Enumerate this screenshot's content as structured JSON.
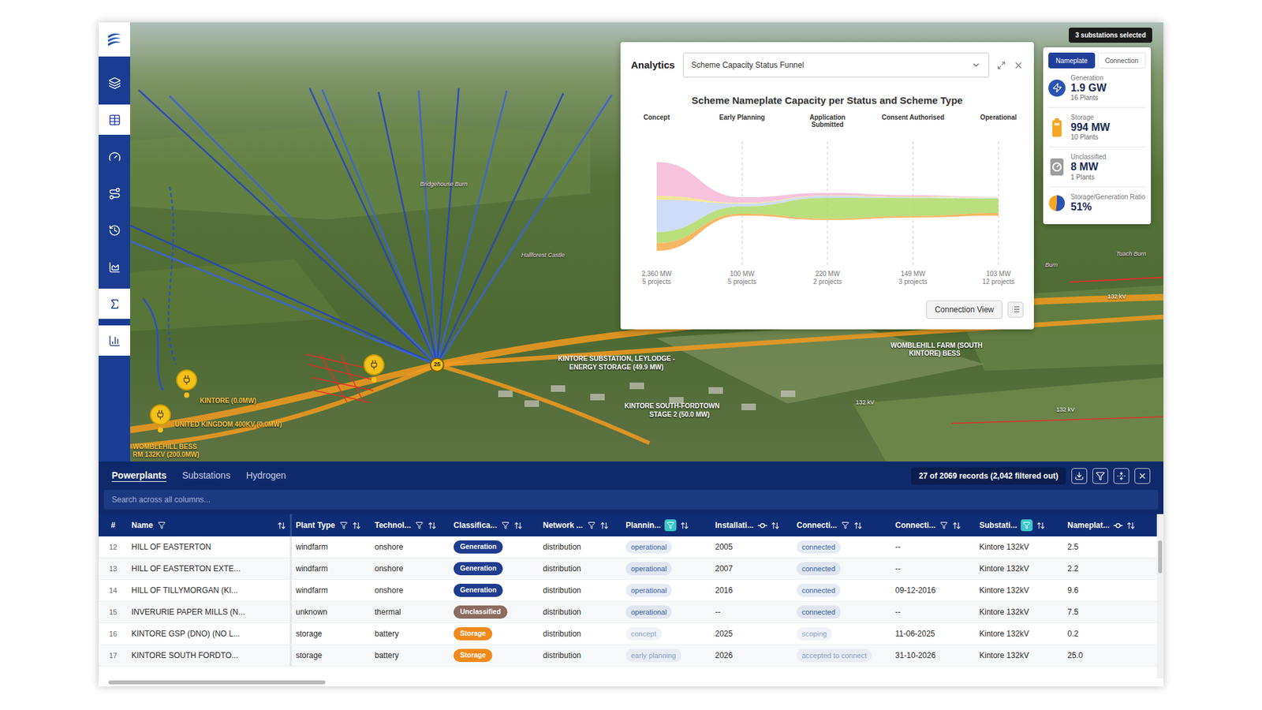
{
  "sidebar": {
    "items": [
      {
        "selected": false
      },
      {
        "selected": true
      },
      {
        "selected": false
      },
      {
        "selected": false
      },
      {
        "selected": false
      },
      {
        "selected": false
      },
      {
        "selected": true
      },
      {
        "selected": true
      }
    ]
  },
  "map": {
    "selection_badge": "3 substations selected",
    "cluster": "25",
    "labels": [
      {
        "text": "KINTORE SUBSTATION, LEYLODGE -",
        "kind": "site"
      },
      {
        "text": "ENERGY STORAGE (49.9 MW)",
        "kind": "site"
      },
      {
        "text": "KINTORE SOUTH-FORDTOWN",
        "kind": "site"
      },
      {
        "text": "STAGE 2 (50.0 MW)",
        "kind": "site"
      },
      {
        "text": "WOMBLEHILL FARM (SOUTH",
        "kind": "site"
      },
      {
        "text": "KINTORE) BESS",
        "kind": "site"
      },
      {
        "text": "132 kV",
        "kind": "voltage"
      },
      {
        "text": "132 kV",
        "kind": "voltage"
      },
      {
        "text": "132 kV",
        "kind": "voltage"
      },
      {
        "text": "Bridgehouse Burn",
        "kind": "place"
      },
      {
        "text": "Hallforest Castle",
        "kind": "place"
      },
      {
        "text": "Tuach Burn",
        "kind": "place"
      },
      {
        "text": "Burn",
        "kind": "place"
      },
      {
        "text": "KINTORE (0.0MW)",
        "kind": "bess"
      },
      {
        "text": "UNITED KINGDOM 400KV (0.0MW)",
        "kind": "bess"
      },
      {
        "text": "WOMBLEHILL BESS",
        "kind": "bess"
      },
      {
        "text": "RM 132KV (200.0MW)",
        "kind": "bess"
      }
    ]
  },
  "analytics": {
    "title": "Analytics",
    "selector": "Scheme Capacity Status Funnel",
    "chart": {
      "title": "Scheme Nameplate Capacity per Status and Scheme Type",
      "stages": [
        {
          "label": "Concept",
          "value": "2,360 MW",
          "projects": "5 projects"
        },
        {
          "label": "Early Planning",
          "value": "100 MW",
          "projects": "5 projects"
        },
        {
          "label": "Application Submitted",
          "value": "220 MW",
          "projects": "2 projects"
        },
        {
          "label": "Consent Authorised",
          "value": "149 MW",
          "projects": "3 projects"
        },
        {
          "label": "Operational",
          "value": "103 MW",
          "projects": "12 projects"
        }
      ],
      "series": [
        {
          "values": [
            900,
            30,
            20,
            9,
            3
          ],
          "color": "#f4b3d3"
        },
        {
          "values": [
            100,
            5,
            5,
            5,
            2
          ],
          "color": "#f3e07c"
        },
        {
          "values": [
            860,
            15,
            15,
            5,
            3
          ],
          "color": "#c2d3f5"
        },
        {
          "values": [
            300,
            40,
            170,
            120,
            80
          ],
          "color": "#a9d75c"
        },
        {
          "values": [
            200,
            10,
            10,
            10,
            15
          ],
          "color": "#f5a53c"
        }
      ]
    },
    "buttons": [
      "Connection View"
    ]
  },
  "summary": {
    "tabs": [
      {
        "label": "Nameplate",
        "selected": true
      },
      {
        "label": "Connection",
        "selected": false
      }
    ],
    "items": [
      {
        "kind": "generation",
        "label": "Generation",
        "value": "1.9 GW",
        "count": "16 Plants"
      },
      {
        "kind": "storage",
        "label": "Storage",
        "value": "994 MW",
        "count": "10 Plants"
      },
      {
        "kind": "unclassified",
        "label": "Unclassified",
        "value": "8 MW",
        "count": "1 Plants"
      },
      {
        "kind": "ratio",
        "label": "Storage/Generation Ratio",
        "value": "51%",
        "level": 0.51
      }
    ]
  },
  "table": {
    "tabs": [
      {
        "label": "Powerplants",
        "selected": true
      },
      {
        "label": "Substations",
        "selected": false
      },
      {
        "label": "Hydrogen",
        "selected": false
      }
    ],
    "records": "27 of 2069 records (2,042 filtered out)",
    "search": {
      "placeholder": "Search across all columns..."
    },
    "columns": [
      {
        "label": "#",
        "kind": "index",
        "filtered": false
      },
      {
        "label": "Name",
        "kind": "list",
        "filtered": false
      },
      {
        "label": "Plant Type",
        "kind": "list",
        "filtered": false
      },
      {
        "label": "Technol...",
        "kind": "list",
        "filtered": false
      },
      {
        "label": "Classifica...",
        "kind": "list",
        "filtered": false
      },
      {
        "label": "Network ...",
        "kind": "list",
        "filtered": false
      },
      {
        "label": "Plannin...",
        "kind": "list",
        "filtered": true
      },
      {
        "label": "Installati...",
        "kind": "range",
        "filtered": false
      },
      {
        "label": "Connecti...",
        "kind": "list",
        "filtered": false
      },
      {
        "label": "Connecti...",
        "kind": "list",
        "filtered": false
      },
      {
        "label": "Substati...",
        "kind": "list",
        "filtered": true
      },
      {
        "label": "Nameplat...",
        "kind": "range",
        "filtered": false
      }
    ],
    "rows": [
      {
        "index": "12",
        "name": "HILL OF EASTERTON",
        "plant_type": "windfarm",
        "technology": "onshore",
        "classification": {
          "text": "Generation",
          "color": "#1f3c8f"
        },
        "network": "distribution",
        "planning": {
          "text": "operational",
          "color": "#3a5fa8"
        },
        "installation": "2005",
        "connection_status": {
          "text": "connected",
          "color": "#3a5fa8"
        },
        "connection_date": "--",
        "substation": "Kintore 132kV",
        "nameplate": "2.5"
      },
      {
        "index": "13",
        "name": "HILL OF EASTERTON EXTE...",
        "plant_type": "windfarm",
        "technology": "onshore",
        "classification": {
          "text": "Generation",
          "color": "#1f3c8f"
        },
        "network": "distribution",
        "planning": {
          "text": "operational",
          "color": "#3a5fa8"
        },
        "installation": "2007",
        "connection_status": {
          "text": "connected",
          "color": "#3a5fa8"
        },
        "connection_date": "--",
        "substation": "Kintore 132kV",
        "nameplate": "2.2"
      },
      {
        "index": "14",
        "name": "HILL OF TILLYMORGAN (KI...",
        "plant_type": "windfarm",
        "technology": "onshore",
        "classification": {
          "text": "Generation",
          "color": "#1f3c8f"
        },
        "network": "distribution",
        "planning": {
          "text": "operational",
          "color": "#3a5fa8"
        },
        "installation": "2016",
        "connection_status": {
          "text": "connected",
          "color": "#3a5fa8"
        },
        "connection_date": "09-12-2016",
        "substation": "Kintore 132kV",
        "nameplate": "9.6"
      },
      {
        "index": "15",
        "name": "INVERURIE PAPER MILLS (N...",
        "plant_type": "unknown",
        "technology": "thermal",
        "classification": {
          "text": "Unclassified",
          "color": "#8c6b61"
        },
        "network": "distribution",
        "planning": {
          "text": "operational",
          "color": "#3a5fa8"
        },
        "installation": "--",
        "connection_status": {
          "text": "connected",
          "color": "#3a5fa8"
        },
        "connection_date": "--",
        "substation": "Kintore 132kV",
        "nameplate": "7.5"
      },
      {
        "index": "16",
        "name": "KINTORE GSP (DNO) (NO L...",
        "plant_type": "storage",
        "technology": "battery",
        "classification": {
          "text": "Storage",
          "color": "#f08a1c"
        },
        "network": "distribution",
        "planning": {
          "text": "concept",
          "color": "#8c9fc6"
        },
        "installation": "2025",
        "connection_status": {
          "text": "scoping",
          "color": "#8c9fc6"
        },
        "connection_date": "11-06-2025",
        "substation": "Kintore 132kV",
        "nameplate": "0.2"
      },
      {
        "index": "17",
        "name": "KINTORE SOUTH FORDTO...",
        "plant_type": "storage",
        "technology": "battery",
        "classification": {
          "text": "Storage",
          "color": "#f08a1c"
        },
        "network": "distribution",
        "planning": {
          "text": "early planning",
          "color": "#8c9fc6"
        },
        "installation": "2026",
        "connection_status": {
          "text": "accepted to connect",
          "color": "#8c9fc6"
        },
        "connection_date": "31-10-2026",
        "substation": "Kintore 132kV",
        "nameplate": "25.0"
      }
    ]
  }
}
